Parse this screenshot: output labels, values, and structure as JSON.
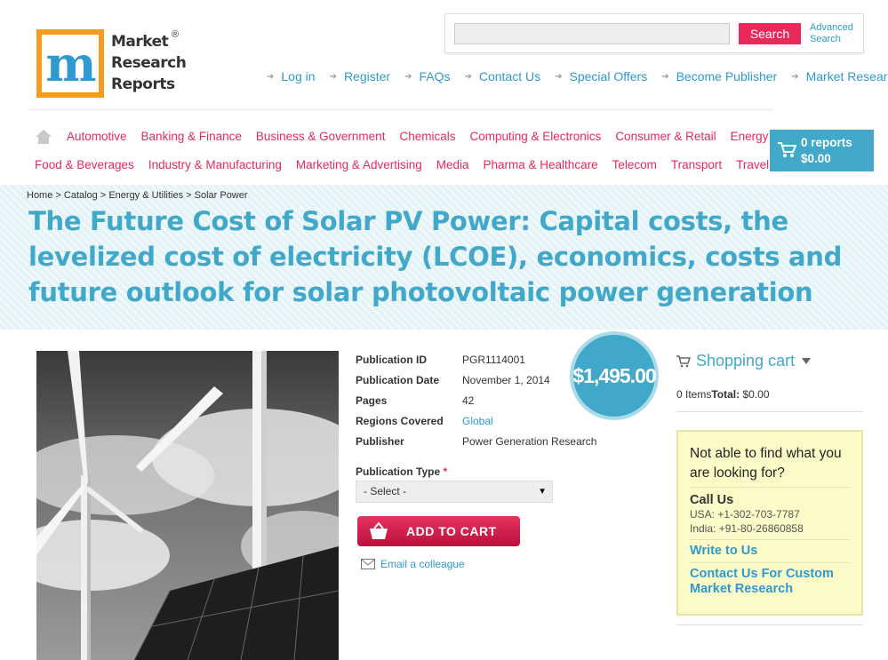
{
  "logo": {
    "letter": "m",
    "text_lines": [
      "Market",
      "Research",
      "Reports"
    ],
    "registered": "®"
  },
  "search": {
    "placeholder": "",
    "button_label": "Search",
    "advanced_label_line1": "Advanced",
    "advanced_label_line2": "Search"
  },
  "top_links": [
    "Log in",
    "Register",
    "FAQs",
    "Contact Us",
    "Special Offers",
    "Become Publisher",
    "Market Research Blog"
  ],
  "categories_row1": [
    "Automotive",
    "Banking & Finance",
    "Business & Government",
    "Chemicals",
    "Computing & Electronics",
    "Consumer & Retail",
    "Energy & Utilities"
  ],
  "categories_row2": [
    "Food & Beverages",
    "Industry & Manufacturing",
    "Marketing & Advertising",
    "Media",
    "Pharma & Healthcare",
    "Telecom",
    "Transport",
    "Travel & Leisure"
  ],
  "header_cart": {
    "reports": "0 reports",
    "amount": "$0.00"
  },
  "breadcrumb": "Home > Catalog > Energy & Utilities > Solar Power",
  "title": "The Future Cost of Solar PV Power: Capital costs, the levelized cost of electricity (LCOE), economics, costs and future outlook for solar photovoltaic power generation",
  "details": {
    "publication_id_label": "Publication ID",
    "publication_id": "PGR1114001",
    "publication_date_label": "Publication Date",
    "publication_date": "November 1, 2014",
    "pages_label": "Pages",
    "pages": "42",
    "regions_label": "Regions Covered",
    "regions": "Global",
    "publisher_label": "Publisher",
    "publisher": "Power Generation Research"
  },
  "price": "$1,495.00",
  "publication_type": {
    "label": "Publication Type",
    "required_mark": "*",
    "selected": "- Select -"
  },
  "add_to_cart_label": "ADD TO CART",
  "email_colleague_label": "Email a colleague",
  "sidebar_cart": {
    "title": "Shopping cart",
    "items": "0 Items",
    "total_label": "Total:",
    "total_value": "$0.00"
  },
  "help_box": {
    "question": "Not able to find what you are looking for?",
    "call_us": "Call Us",
    "usa": "USA: +1-302-703-7787",
    "india": "India: +91-80-26860858",
    "write_to_us": "Write to Us",
    "contact_custom": "Contact Us For Custom Market Research"
  },
  "colors": {
    "accent_pink": "#e8295a",
    "accent_blue": "#41a8c9",
    "logo_orange": "#f39c1f"
  }
}
